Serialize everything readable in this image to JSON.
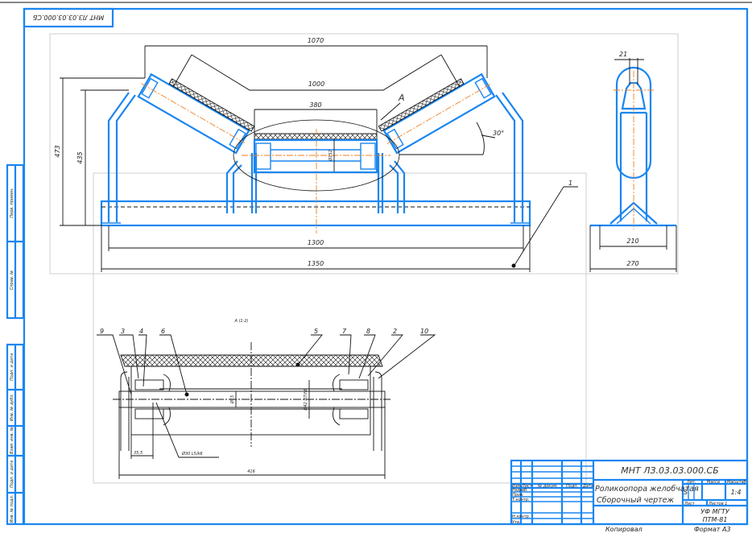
{
  "drawing": {
    "stamp_mirrored": "МНТ ЛЗ.03.03.000.СБ",
    "main_view": {
      "dims": {
        "d1070": "1070",
        "d1000": "1000",
        "d380": "380",
        "d473": "473",
        "d435": "435",
        "d1300": "1300",
        "d1350": "1350",
        "angle": "30°",
        "d152": "Ø152"
      },
      "view_marker": "A",
      "callout_1": "1"
    },
    "side_view": {
      "dims": {
        "d21": "21",
        "d210": "210",
        "d270": "270"
      }
    },
    "detail_view": {
      "title": "А (1:2)",
      "callouts": [
        "9",
        "3",
        "4",
        "6",
        "5",
        "7",
        "8",
        "2",
        "10"
      ],
      "dims": {
        "d35_5": "35,5",
        "fit_bearing": "Ø30 L5/k6",
        "shaft": "Ø15",
        "housing": "Ø42 H7/h8",
        "d416": "416"
      }
    }
  },
  "title_block": {
    "designation": "МНТ ЛЗ.03.03.000.СБ",
    "name_line1": "Роликоопора желобчатая",
    "name_line2": "Сборочный чертеж",
    "headers": [
      "Изм.",
      "Лист",
      "№ докум.",
      "Подп.",
      "Дата"
    ],
    "roles": [
      "Разраб.",
      "Пров.",
      "Т.контр.",
      "Н.контр.",
      "Утв."
    ],
    "lit_label": "Лит.",
    "mass_label": "Масса",
    "scale_label": "Масштаб",
    "scale_value": "1:4",
    "letter": "S",
    "sheet_label": "Лист",
    "sheets_label": "Листов 1",
    "org_line1": "УФ МГТУ",
    "org_line2": "ПТМ-81",
    "copied": "Копировал",
    "format": "Формат А3"
  },
  "side_strip": [
    "Перв. примен.",
    "Справ. №",
    "Инв. № подл.",
    "Подп. и дата",
    "Взам. инв. №",
    "Инв. № дубл.",
    "Подп. и дата"
  ]
}
